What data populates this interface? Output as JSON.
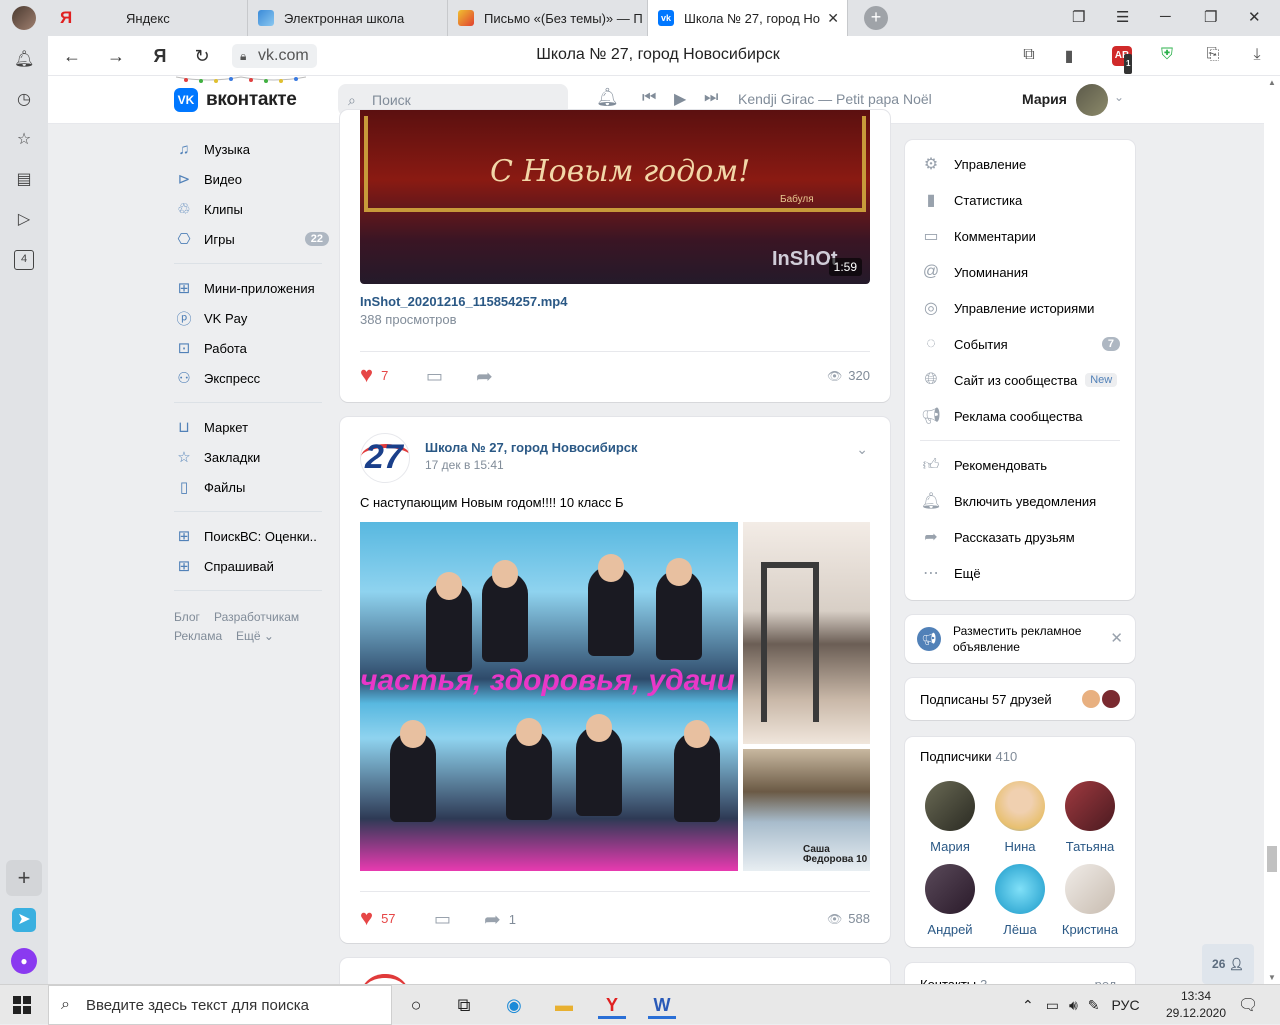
{
  "tabs": [
    {
      "label": "Яндекс"
    },
    {
      "label": "Электронная школа"
    },
    {
      "label": "Письмо «(Без темы)» — П"
    },
    {
      "label": "Школа № 27, город Но"
    }
  ],
  "address": {
    "url": "vk.com",
    "page_title": "Школа № 27, город Новосибирск",
    "adblock_count": "1"
  },
  "vk_header": {
    "logo_text": "вконтакте",
    "search_placeholder": "Поиск",
    "track": "Kendji Girac — Petit papa Noël",
    "user_name": "Мария"
  },
  "left_menu": {
    "items": [
      {
        "label": "Музыка",
        "icon": "music-icon"
      },
      {
        "label": "Видео",
        "icon": "video-icon"
      },
      {
        "label": "Клипы",
        "icon": "clips-icon"
      },
      {
        "label": "Игры",
        "icon": "games-icon",
        "count": "22"
      },
      {
        "label": "Мини-приложения",
        "icon": "apps-icon"
      },
      {
        "label": "VK Pay",
        "icon": "vkpay-icon"
      },
      {
        "label": "Работа",
        "icon": "work-icon"
      },
      {
        "label": "Экспресс",
        "icon": "express-icon"
      },
      {
        "label": "Маркет",
        "icon": "market-icon"
      },
      {
        "label": "Закладки",
        "icon": "bookmarks-icon"
      },
      {
        "label": "Файлы",
        "icon": "files-icon"
      },
      {
        "label": "ПоискВС: Оценки..",
        "icon": "app-icon"
      },
      {
        "label": "Спрашивай",
        "icon": "app-icon"
      }
    ],
    "footer": [
      "Блог",
      "Разработчикам",
      "Реклама",
      "Ещё"
    ]
  },
  "post1": {
    "video_title": "InShot_20201216_115854257.mp4",
    "video_views": "388 просмотров",
    "duration": "1:59",
    "overlay_text": "С Новым годом!",
    "overlay_signature": "Бабуля",
    "watermark": "InShOt",
    "likes": "7",
    "views": "320"
  },
  "post2": {
    "author": "Школа № 27, город Новосибирск",
    "date": "17 дек в 15:41",
    "text": "С наступающим Новым годом!!!! 10 класс Б",
    "photo_overlay": "частья, здоровья, удачи",
    "photo3_caption": "Саша Федорова 10",
    "likes": "57",
    "shares": "1",
    "views": "588"
  },
  "right_menu": {
    "items": [
      {
        "label": "Управление",
        "icon": "gear-icon"
      },
      {
        "label": "Статистика",
        "icon": "stats-icon"
      },
      {
        "label": "Комментарии",
        "icon": "comments-icon"
      },
      {
        "label": "Упоминания",
        "icon": "at-icon"
      },
      {
        "label": "Управление историями",
        "icon": "stories-icon"
      },
      {
        "label": "События",
        "icon": "events-icon",
        "count": "7"
      },
      {
        "label": "Сайт из сообщества",
        "icon": "globe-icon",
        "badge": "New"
      },
      {
        "label": "Реклама сообщества",
        "icon": "megaphone-icon"
      },
      {
        "label": "Рекомендовать",
        "icon": "thumbs-up-icon"
      },
      {
        "label": "Включить уведомления",
        "icon": "bell-icon"
      },
      {
        "label": "Рассказать друзьям",
        "icon": "share-icon"
      },
      {
        "label": "Ещё",
        "icon": "more-icon"
      }
    ]
  },
  "ad_card": {
    "text": "Разместить рекламное объявление"
  },
  "friends_card": {
    "text": "Подписаны 57 друзей"
  },
  "subscribers": {
    "title": "Подписчики",
    "count": "410",
    "people": [
      {
        "name": "Мария",
        "color": "#4a4a3a"
      },
      {
        "name": "Нина",
        "color": "#e8c070"
      },
      {
        "name": "Татьяна",
        "color": "#7a2a30"
      },
      {
        "name": "Андрей",
        "color": "#3a2a3a"
      },
      {
        "name": "Лёша",
        "color": "#2aa8d8"
      },
      {
        "name": "Кристина",
        "color": "#d8d0c8"
      }
    ]
  },
  "contacts": {
    "title": "Контакты",
    "count": "3",
    "right": "ред."
  },
  "chat_button": {
    "count": "26"
  },
  "taskbar": {
    "search_placeholder": "Введите здесь текст для поиска",
    "lang": "РУС",
    "time": "13:34",
    "date": "29.12.2020"
  }
}
